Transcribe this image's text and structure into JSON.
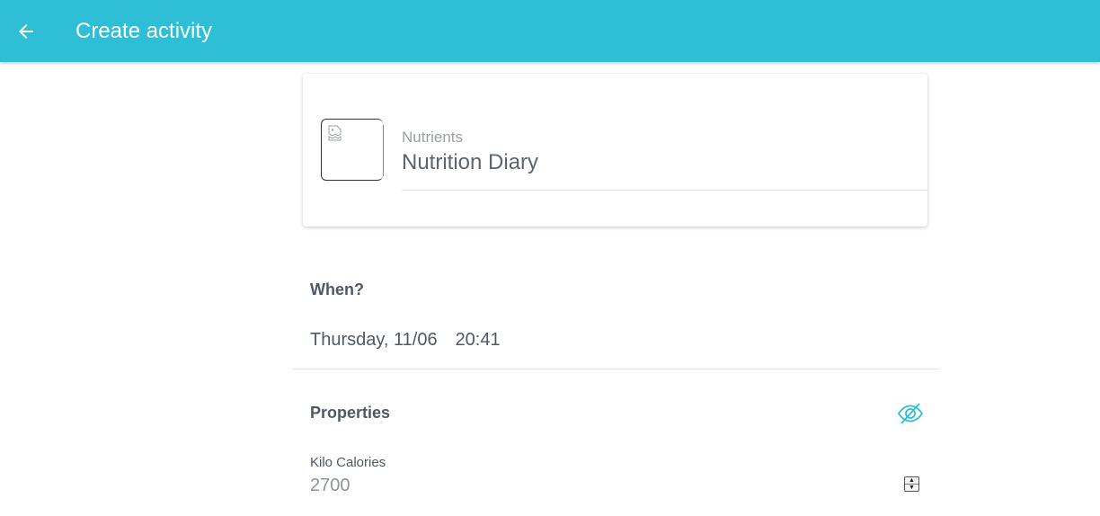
{
  "header": {
    "title": "Create activity",
    "back_icon": "arrow-left-icon",
    "background_color": "#2ebfd6"
  },
  "activity_card": {
    "thumbnail_icon": "broken-image-icon",
    "category": "Nutrients",
    "title": "Nutrition Diary"
  },
  "when": {
    "label": "When?",
    "date": "Thursday, 11/06",
    "time": "20:41"
  },
  "properties": {
    "label": "Properties",
    "visibility_icon": "eye-off-icon",
    "accent_color": "#2ebfd6",
    "fields": [
      {
        "label": "Kilo Calories",
        "value": "2700"
      }
    ]
  }
}
